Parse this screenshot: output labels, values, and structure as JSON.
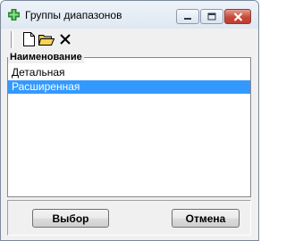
{
  "window": {
    "title": "Группы диапазонов"
  },
  "icons": {
    "app": "green-plus-cross-icon",
    "minimize": "minimize-icon",
    "maximize": "maximize-icon",
    "close": "close-icon",
    "new": "new-document-icon",
    "open": "open-folder-icon",
    "delete": "delete-x-icon"
  },
  "list": {
    "header": "Наименование",
    "items": [
      {
        "label": "Детальная",
        "selected": false
      },
      {
        "label": "Расширенная",
        "selected": true
      }
    ]
  },
  "buttons": {
    "select": "Выбор",
    "cancel": "Отмена"
  },
  "colors": {
    "selection": "#3399ff",
    "close_button": "#c7493a",
    "app_icon": "#2e9e3a"
  }
}
